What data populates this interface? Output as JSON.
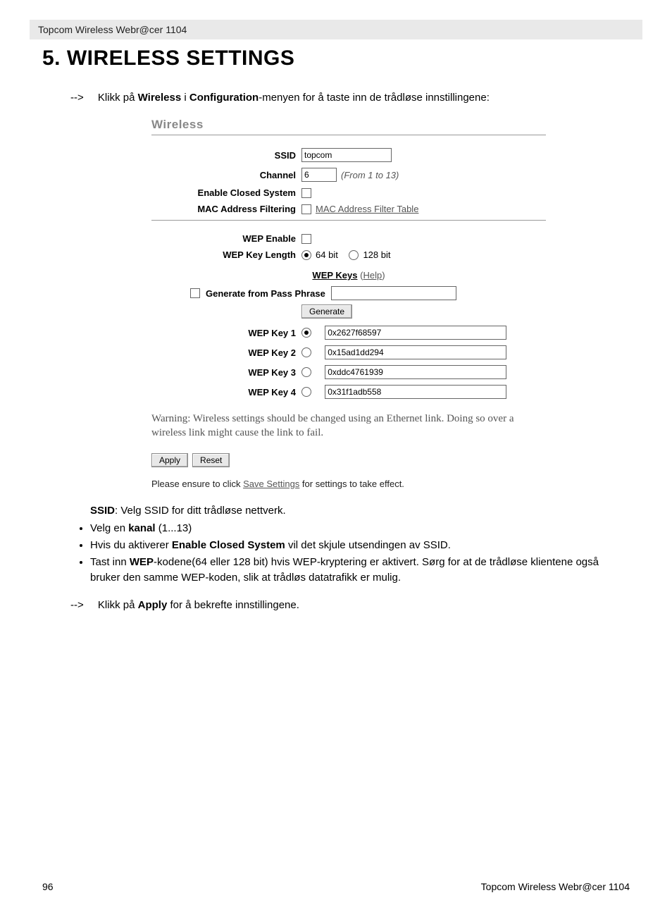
{
  "header": {
    "product": "Topcom Wireless Webr@cer 1104"
  },
  "title": "5.  WIRELESS SETTINGS",
  "intro": {
    "arrow": "-->",
    "text_pre": "Klikk på ",
    "w1": "Wireless",
    "mid": " i ",
    "w2": "Configuration",
    "text_post": "-menyen for å taste inn de trådløse innstillingene:"
  },
  "panel": {
    "section_title": "Wireless",
    "ssid_label": "SSID",
    "ssid_value": "topcom",
    "channel_label": "Channel",
    "channel_value": "6",
    "channel_hint": "(From 1 to 13)",
    "closed_label": "Enable Closed System",
    "macfilter_label": "MAC Address Filtering",
    "macfilter_link": "MAC Address Filter Table",
    "wep_enable_label": "WEP Enable",
    "wep_len_label": "WEP Key Length",
    "wep_len_64": "64 bit",
    "wep_len_128": "128 bit",
    "wepkeys_heading": "WEP Keys",
    "help": "Help",
    "passphrase_label": "Generate from Pass Phrase",
    "passphrase_value": "",
    "generate_btn": "Generate",
    "keys": [
      {
        "label": "WEP Key 1",
        "value": "0x2627f68597",
        "selected": true
      },
      {
        "label": "WEP Key 2",
        "value": "0x15ad1dd294",
        "selected": false
      },
      {
        "label": "WEP Key 3",
        "value": "0xddc4761939",
        "selected": false
      },
      {
        "label": "WEP Key 4",
        "value": "0x31f1adb558",
        "selected": false
      }
    ],
    "warning": "Warning: Wireless settings should be changed using an Ethernet link. Doing so over a wireless link might cause the link to fail.",
    "apply_btn": "Apply",
    "reset_btn": "Reset",
    "save_note_pre": "Please ensure to click ",
    "save_link": "Save Settings",
    "save_note_post": " for settings to take effect."
  },
  "notes": {
    "ssid_pre": "SSID",
    "ssid_post": ": Velg SSID for ditt trådløse nettverk.",
    "b1_pre": "Velg en ",
    "b1_b": "kanal",
    "b1_post": " (1...13)",
    "b2_pre": "Hvis du aktiverer ",
    "b2_b": "Enable Closed System",
    "b2_post": " vil det skjule utsendingen av SSID.",
    "b3_pre": "Tast inn ",
    "b3_b": "WEP",
    "b3_post": "-kodene(64 eller 128 bit) hvis WEP-kryptering er aktivert. Sørg for at de trådløse klientene også bruker den samme WEP-koden, slik at trådløs datatrafikk er mulig."
  },
  "outro": {
    "arrow": "-->",
    "text_pre": "Klikk på ",
    "w": "Apply",
    "text_post": " for å bekrefte innstillingene."
  },
  "footer": {
    "page": "96",
    "product": "Topcom Wireless Webr@cer 1104"
  }
}
